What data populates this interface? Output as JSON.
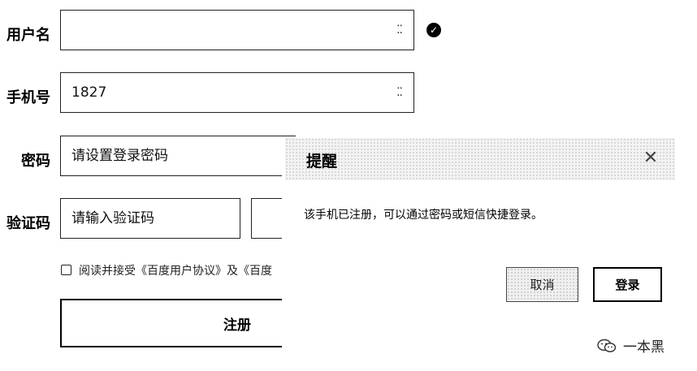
{
  "form": {
    "username_label": "用户名",
    "username_value": "",
    "phone_label": "手机号",
    "phone_value": "1827",
    "password_label": "密码",
    "password_placeholder": "请设置登录密码",
    "code_label": "验证码",
    "code_placeholder": "请输入验证码",
    "agree_text": "阅读并接受《百度用户协议》及《百度",
    "register_label": "注册"
  },
  "dialog": {
    "title": "提醒",
    "message": "该手机已注册，可以通过密码或短信快捷登录。",
    "cancel_label": "取消",
    "login_label": "登录"
  },
  "watermark": {
    "text": "一本黑"
  }
}
